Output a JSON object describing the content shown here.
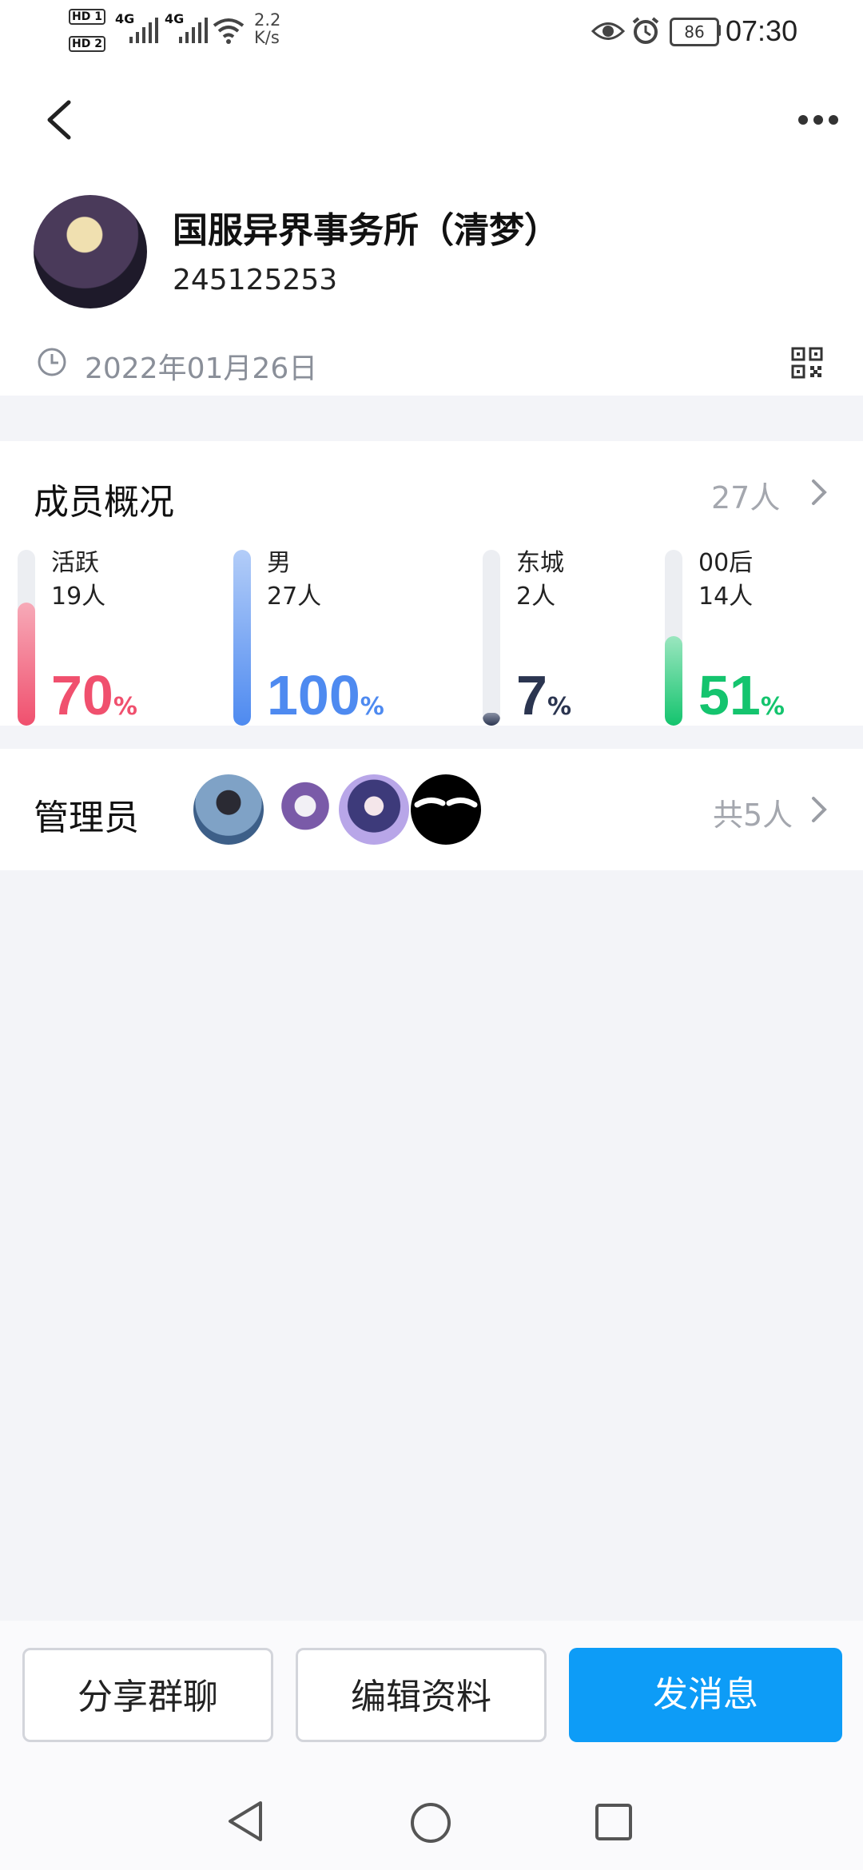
{
  "status_bar": {
    "hd1": "HD 1",
    "hd2": "HD 2",
    "net1": "4G",
    "net2": "4G",
    "speed_value": "2.2",
    "speed_unit": "K/s",
    "battery": "86",
    "time": "07:30"
  },
  "header": {
    "back_icon": "chevron-left-icon",
    "more_icon": "more-dots-icon",
    "group_name": "国服异界事务所（清梦）",
    "group_id": "245125253",
    "created_date": "2022年01月26日",
    "qr_icon": "qr-code-icon"
  },
  "members": {
    "title": "成员概况",
    "total": "27人",
    "stats": [
      {
        "label": "活跃",
        "count": "19人",
        "percent": "70",
        "unit": "%",
        "fraction": 0.7,
        "color": "#f0506e",
        "fill_top": "#f7aab8"
      },
      {
        "label": "男",
        "count": "27人",
        "percent": "100",
        "unit": "%",
        "fraction": 1.0,
        "color": "#4e8af0",
        "fill_top": "#b3cdf8"
      },
      {
        "label": "东城",
        "count": "2人",
        "percent": "7",
        "unit": "%",
        "fraction": 0.07,
        "color": "#2b3550",
        "fill_top": "#8890a4"
      },
      {
        "label": "00后",
        "count": "14人",
        "percent": "51",
        "unit": "%",
        "fraction": 0.51,
        "color": "#14c46e",
        "fill_top": "#9ae6bf"
      }
    ]
  },
  "admins": {
    "title": "管理员",
    "total": "共5人"
  },
  "actions": {
    "share": "分享群聊",
    "edit": "编辑资料",
    "message": "发消息"
  }
}
